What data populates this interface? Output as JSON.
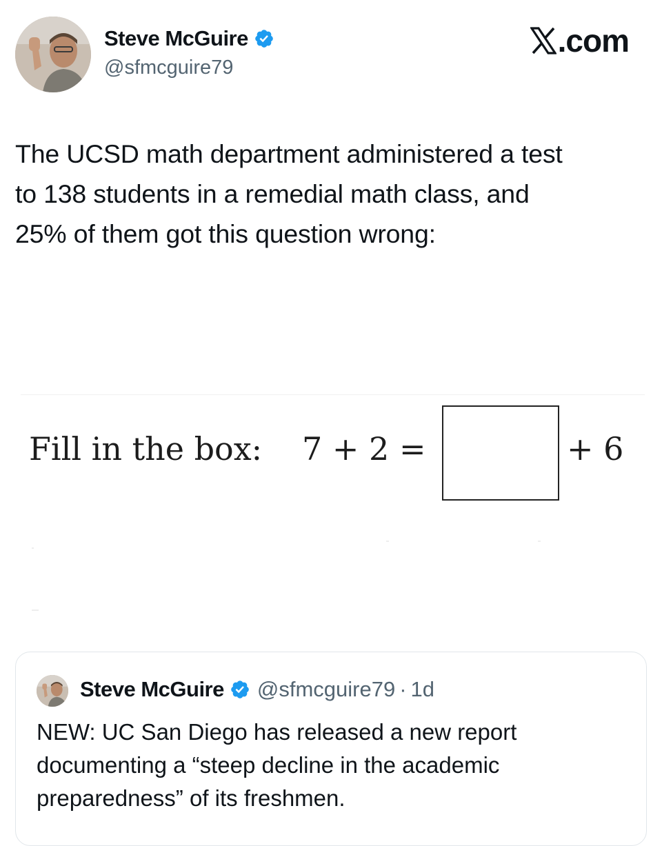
{
  "header": {
    "author_name": "Steve McGuire",
    "author_handle": "@sfmcguire79",
    "verified_icon": "verified-badge-icon",
    "site_label": ".com",
    "site_icon": "x-logo-icon"
  },
  "tweet": {
    "text_lines": [
      "The UCSD math department administered a test",
      "to 138 students in a remedial math class, and",
      "25% of them got this question wrong:"
    ]
  },
  "math_image": {
    "label": "Fill in the box:",
    "lhs": "7 + 2 =",
    "rhs": "+ 6"
  },
  "quoted_tweet": {
    "author_name": "Steve McGuire",
    "author_handle": "@sfmcguire79",
    "separator": "·",
    "age": "1d",
    "text_lines": [
      "NEW: UC San Diego has released a new report",
      "documenting a “steep decline in the academic",
      "preparedness” of its freshmen."
    ]
  },
  "colors": {
    "verified_blue": "#1d9bf0",
    "handle_gray": "#536471",
    "text": "#0f1419",
    "card_border": "#e1e6ea"
  }
}
